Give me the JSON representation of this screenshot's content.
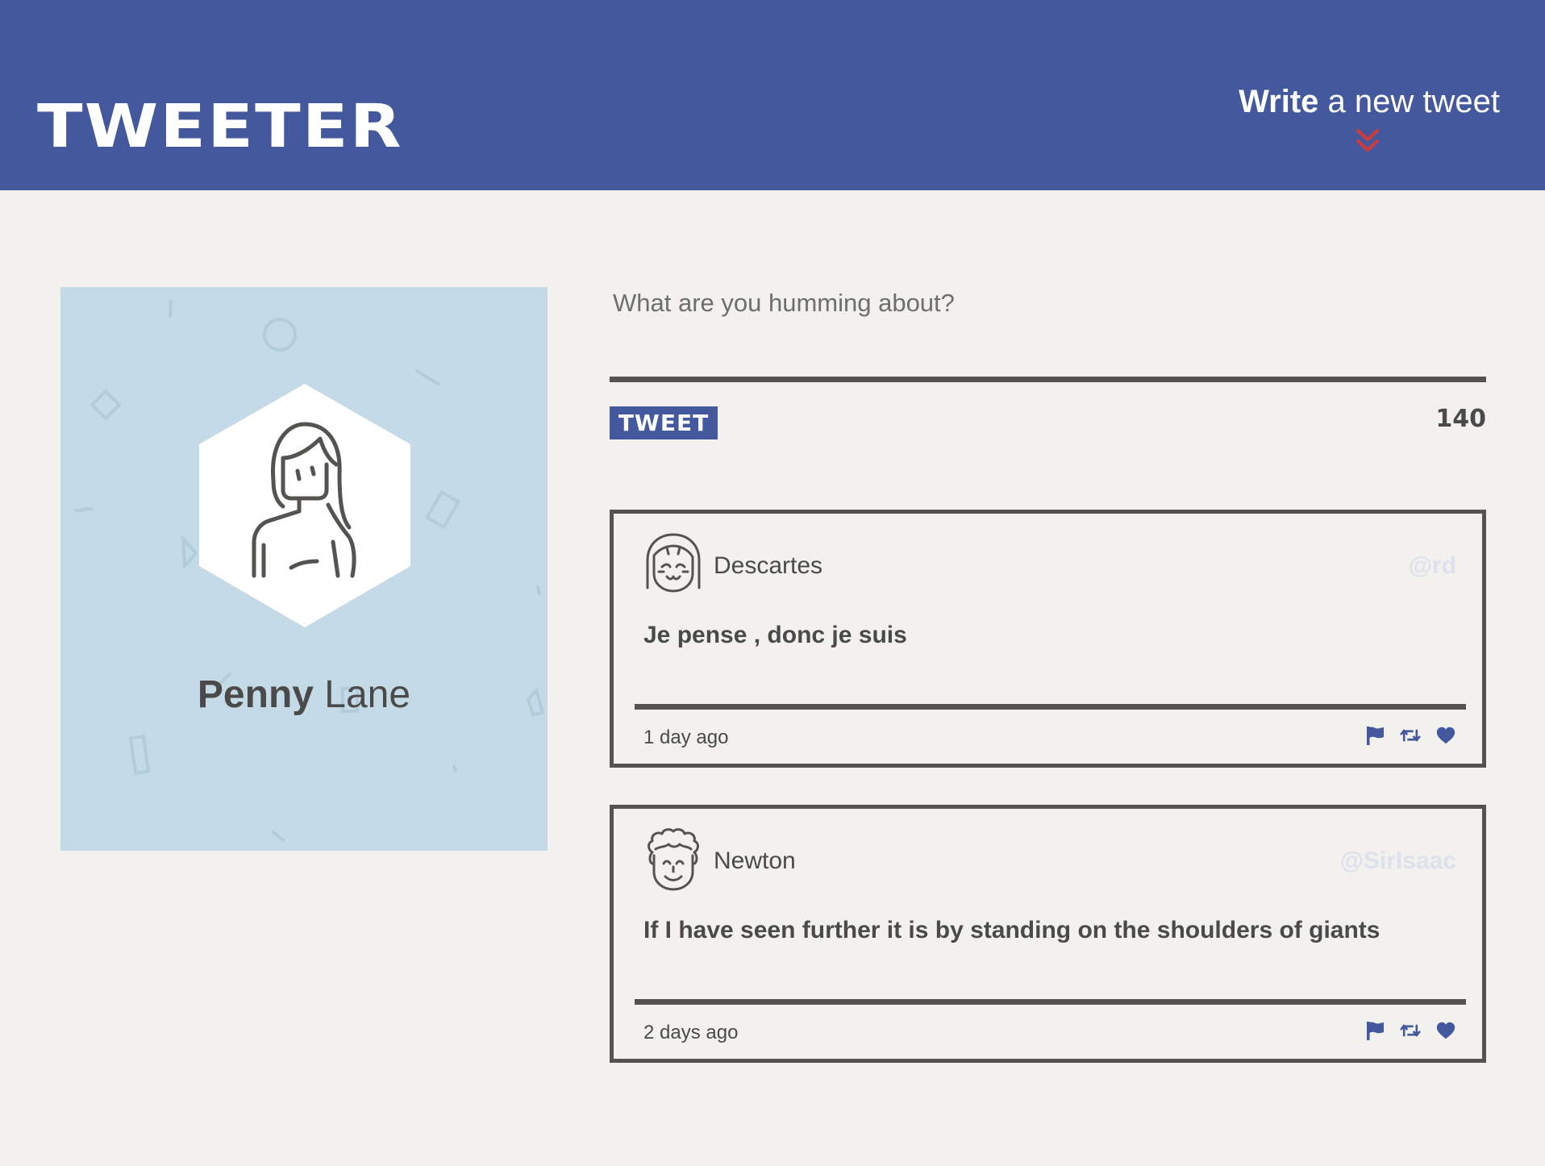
{
  "brand": {
    "logo": "TWEETER",
    "header_color": "#43589d"
  },
  "compose_toggle": {
    "bold": "Write",
    "rest": " a new tweet",
    "icon": "chevron-double-down-icon",
    "icon_color": "#d23a3a"
  },
  "profile": {
    "first_name": "Penny",
    "last_name": " Lane",
    "avatar_icon": "woman-avatar-icon",
    "card_color": "#c4dae7"
  },
  "compose": {
    "placeholder": "What are you humming about?",
    "button_label": "TWEET",
    "counter": "140"
  },
  "tweets": [
    {
      "name": "Descartes",
      "handle": "@rd",
      "content": "Je pense , donc je suis",
      "time": "1 day ago",
      "avatar_icon": "girl-avatar-icon"
    },
    {
      "name": "Newton",
      "handle": "@SirIsaac",
      "content": "If I have seen further it is by standing on the shoulders of giants",
      "time": "2 days ago",
      "avatar_icon": "curly-hair-avatar-icon"
    }
  ],
  "actions": {
    "flag_icon": "flag-icon",
    "retweet_icon": "retweet-icon",
    "like_icon": "heart-icon",
    "color": "#43589d"
  }
}
